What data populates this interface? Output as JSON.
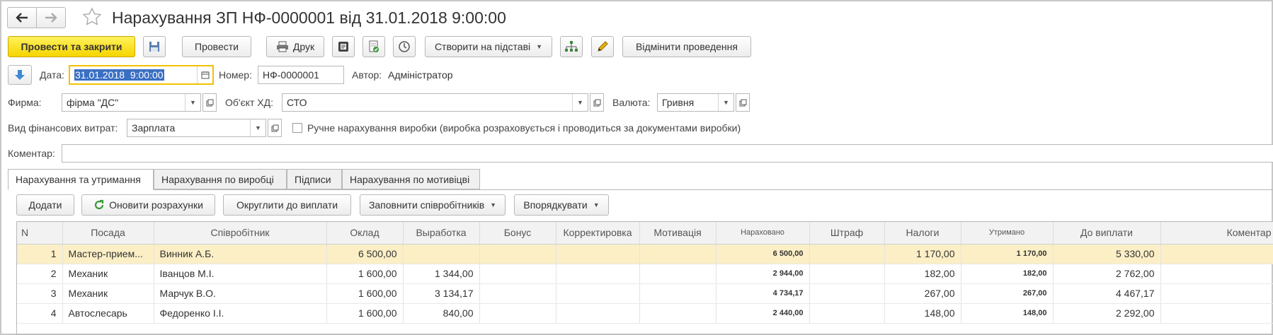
{
  "window": {
    "title": "Нарахування ЗП НФ-0000001 від 31.01.2018 9:00:00",
    "back_icon": "arrow-left-icon",
    "forward_icon": "arrow-right-icon",
    "favorite_icon": "star-icon"
  },
  "toolbar": {
    "post_close": "Провести та закрити",
    "post": "Провести",
    "print": "Друк",
    "create_based": "Створити на підставі",
    "cancel_posting": "Відмінити проведення"
  },
  "header": {
    "date_label": "Дата:",
    "date_value": "31.01.2018  9:00:00",
    "number_label": "Номер:",
    "number_value": "НФ-0000001",
    "author_label": "Автор:",
    "author_value": "Адміністратор",
    "firm_label": "Фирма:",
    "firm_value": "фірма \"ДС\"",
    "object_label": "Об'єкт ХД:",
    "object_value": "СТО",
    "currency_label": "Валюта:",
    "currency_value": "Гривня",
    "expense_label": "Вид фінансових витрат:",
    "expense_value": "Зарплата",
    "manual_label": "Ручне нарахування виробки (виробка розраховується і проводиться за документами виробки)",
    "comment_label": "Коментар:",
    "comment_value": ""
  },
  "tabs": [
    {
      "label": "Нарахування та утримання"
    },
    {
      "label": "Нарахування по виробці"
    },
    {
      "label": "Підписи"
    },
    {
      "label": "Нарахування по мотивіцві"
    }
  ],
  "table_toolbar": {
    "add": "Додати",
    "refresh": "Оновити розрахунки",
    "round": "Округлити до виплати",
    "fill": "Заповнити співробітників",
    "sort": "Впорядкувати"
  },
  "table": {
    "columns": [
      "N",
      "Посада",
      "Співробітник",
      "Оклад",
      "Выработка",
      "Бонус",
      "Корректировка",
      "Мотивація",
      "Нараховано",
      "Штраф",
      "Налоги",
      "Утримано",
      "До виплати",
      "Коментар"
    ],
    "rows": [
      {
        "n": "1",
        "position": "Мастер-прием...",
        "employee": "Винник А.Б.",
        "salary": "6 500,00",
        "output": "",
        "bonus": "",
        "correction": "",
        "motivation": "",
        "accrued": "6 500,00",
        "fine": "",
        "taxes": "1 170,00",
        "withheld": "1 170,00",
        "payout": "5 330,00",
        "comment": ""
      },
      {
        "n": "2",
        "position": "Механик",
        "employee": "Іванцов  М.І.",
        "salary": "1 600,00",
        "output": "1 344,00",
        "bonus": "",
        "correction": "",
        "motivation": "",
        "accrued": "2 944,00",
        "fine": "",
        "taxes": "182,00",
        "withheld": "182,00",
        "payout": "2 762,00",
        "comment": ""
      },
      {
        "n": "3",
        "position": "Механик",
        "employee": "Марчук В.О.",
        "salary": "1 600,00",
        "output": "3 134,17",
        "bonus": "",
        "correction": "",
        "motivation": "",
        "accrued": "4 734,17",
        "fine": "",
        "taxes": "267,00",
        "withheld": "267,00",
        "payout": "4 467,17",
        "comment": ""
      },
      {
        "n": "4",
        "position": "Автослесарь",
        "employee": "Федоренко І.І.",
        "salary": "1 600,00",
        "output": "840,00",
        "bonus": "",
        "correction": "",
        "motivation": "",
        "accrued": "2 440,00",
        "fine": "",
        "taxes": "148,00",
        "withheld": "148,00",
        "payout": "2 292,00",
        "comment": ""
      }
    ]
  },
  "colors": {
    "accent_yellow": "#f5d400",
    "selected_row": "#fcefc6",
    "date_highlight": "#3a6fc4",
    "tax_red": "#8a1c1c"
  }
}
